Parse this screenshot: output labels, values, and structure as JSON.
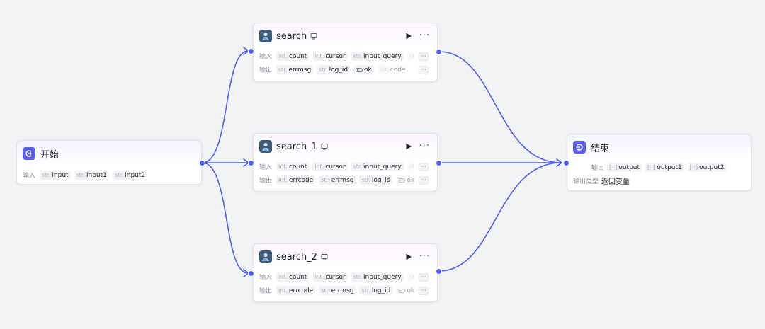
{
  "colors": {
    "accent": "#5b5ff0",
    "wire": "#4e5ef0",
    "canvas": "#f2f3f5"
  },
  "start": {
    "title": "开始",
    "input_label": "输入",
    "inputs": [
      {
        "type": "str.",
        "name": "input"
      },
      {
        "type": "str.",
        "name": "input1"
      },
      {
        "type": "str.",
        "name": "input2"
      }
    ]
  },
  "searches": [
    {
      "title": "search",
      "input_label": "输入",
      "output_label": "输出",
      "inputs": [
        {
          "type": "int.",
          "name": "count"
        },
        {
          "type": "int.",
          "name": "cursor"
        },
        {
          "type": "str.",
          "name": "input_query"
        }
      ],
      "outputs": [
        {
          "type": "str.",
          "name": "errmsg"
        },
        {
          "type": "str.",
          "name": "log_id"
        },
        {
          "type": "bool",
          "name": "ok"
        },
        {
          "type": "int.",
          "name": "code"
        }
      ],
      "overflow": "···"
    },
    {
      "title": "search_1",
      "input_label": "输入",
      "output_label": "输出",
      "inputs": [
        {
          "type": "int.",
          "name": "count"
        },
        {
          "type": "int.",
          "name": "cursor"
        },
        {
          "type": "str.",
          "name": "input_query"
        }
      ],
      "outputs": [
        {
          "type": "int.",
          "name": "errcode"
        },
        {
          "type": "str.",
          "name": "errmsg"
        },
        {
          "type": "str.",
          "name": "log_id"
        },
        {
          "type": "bool",
          "name": "ok"
        }
      ],
      "overflow": "···"
    },
    {
      "title": "search_2",
      "input_label": "输入",
      "output_label": "输出",
      "inputs": [
        {
          "type": "int.",
          "name": "count"
        },
        {
          "type": "int.",
          "name": "cursor"
        },
        {
          "type": "str.",
          "name": "input_query"
        }
      ],
      "outputs": [
        {
          "type": "int.",
          "name": "errcode"
        },
        {
          "type": "str.",
          "name": "errmsg"
        },
        {
          "type": "str.",
          "name": "log_id"
        },
        {
          "type": "bool",
          "name": "ok"
        }
      ],
      "overflow": "···"
    }
  ],
  "end": {
    "title": "结束",
    "output_label": "输出",
    "outputs": [
      "output",
      "output1",
      "output2"
    ],
    "output_type_label": "输出类型",
    "output_type_value": "返回变量"
  },
  "more_label": "···"
}
